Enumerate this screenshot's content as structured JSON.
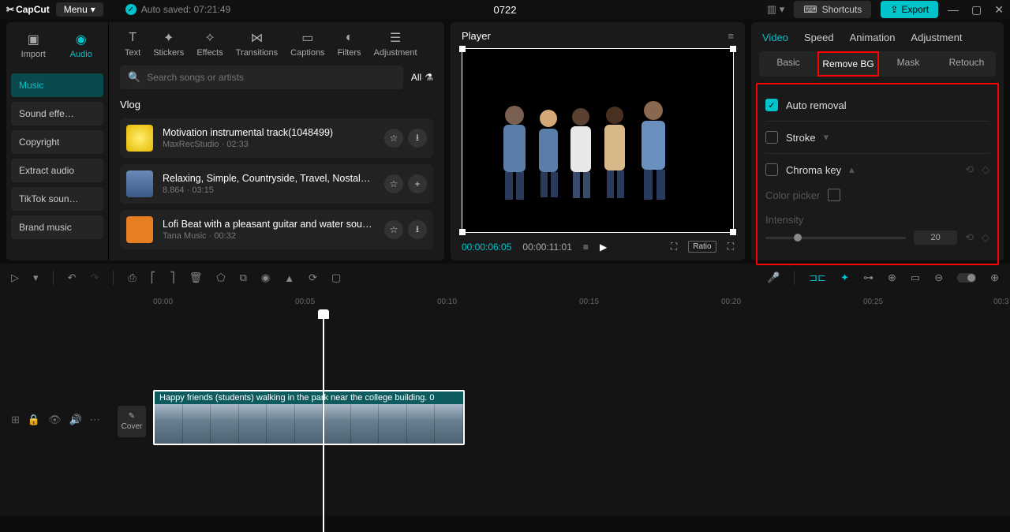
{
  "titlebar": {
    "logo": "CapCut",
    "menu": "Menu",
    "autosave": "Auto saved: 07:21:49",
    "project": "0722",
    "shortcuts": "Shortcuts",
    "export": "Export"
  },
  "mediaTabs": [
    "Import",
    "Audio",
    "Text",
    "Stickers",
    "Effects",
    "Transitions",
    "Captions",
    "Filters",
    "Adjustment"
  ],
  "sideCategories": [
    "Music",
    "Sound effe…",
    "Copyright",
    "Extract audio",
    "TikTok soun…",
    "Brand music"
  ],
  "search": {
    "placeholder": "Search songs or artists",
    "all": "All"
  },
  "audioSection": "Vlog",
  "tracks": [
    {
      "title": "Motivation instrumental track(1048499)",
      "meta": "MaxRecStudio · 02:33",
      "thumb": "#e6b800"
    },
    {
      "title": "Relaxing, Simple, Countryside, Travel, Nostalgi…",
      "meta": "8.864 · 03:15",
      "thumb": "#4a6a9a"
    },
    {
      "title": "Lofi Beat with a pleasant guitar and water soun…",
      "meta": "Tana Music · 00:32",
      "thumb": "#e67e22"
    }
  ],
  "player": {
    "label": "Player",
    "current": "00:00:06:05",
    "total": "00:00:11:01",
    "ratio": "Ratio"
  },
  "props": {
    "tabs": [
      "Video",
      "Speed",
      "Animation",
      "Adjustment"
    ],
    "subtabs": [
      "Basic",
      "Remove BG",
      "Mask",
      "Retouch"
    ],
    "auto_removal": "Auto removal",
    "stroke": "Stroke",
    "chroma": "Chroma key",
    "color_picker": "Color picker",
    "intensity": "Intensity",
    "intensity_val": "20"
  },
  "timeline": {
    "marks": [
      "00:00",
      "00:05",
      "00:10",
      "00:15",
      "00:20",
      "00:25",
      "00:3"
    ],
    "clip_label": "Happy friends (students) walking in the park near the college building.   0",
    "cover": "Cover"
  }
}
